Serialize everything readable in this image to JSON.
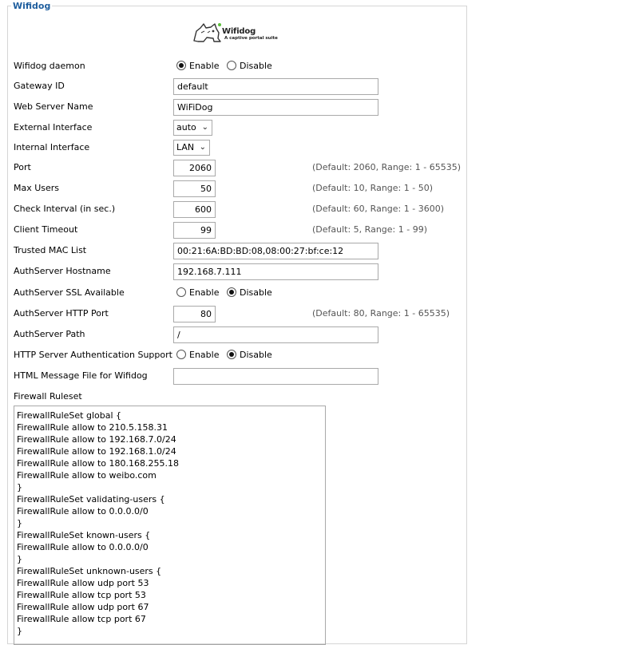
{
  "section": {
    "title": "Wifidog"
  },
  "logo": {
    "title": "Wifidog",
    "subtitle": "A captive portal suite"
  },
  "daemon": {
    "label": "Wifidog daemon",
    "options": [
      "Enable",
      "Disable"
    ],
    "selected": "Enable"
  },
  "gateway_id": {
    "label": "Gateway ID",
    "value": "default"
  },
  "web_server_name": {
    "label": "Web Server Name",
    "value": "WiFiDog"
  },
  "external_interface": {
    "label": "External Interface",
    "value": "auto"
  },
  "internal_interface": {
    "label": "Internal Interface",
    "value": "LAN"
  },
  "port": {
    "label": "Port",
    "value": "2060",
    "hint": "(Default: 2060, Range: 1 - 65535)"
  },
  "max_users": {
    "label": "Max Users",
    "value": "50",
    "hint": "(Default: 10, Range: 1 - 50)"
  },
  "check_interval": {
    "label": "Check Interval (in sec.)",
    "value": "600",
    "hint": "(Default: 60, Range: 1 - 3600)"
  },
  "client_timeout": {
    "label": "Client Timeout",
    "value": "99",
    "hint": "(Default: 5, Range: 1 - 99)"
  },
  "trusted_mac": {
    "label": "Trusted MAC List",
    "value": "00:21:6A:BD:BD:08,08:00:27:bf:ce:12"
  },
  "auth_hostname": {
    "label": "AuthServer Hostname",
    "value": "192.168.7.111"
  },
  "auth_ssl": {
    "label": "AuthServer SSL Available",
    "options": [
      "Enable",
      "Disable"
    ],
    "selected": "Disable"
  },
  "auth_http_port": {
    "label": "AuthServer HTTP Port",
    "value": "80",
    "hint": "(Default: 80, Range: 1 - 65535)"
  },
  "auth_path": {
    "label": "AuthServer Path",
    "value": "/"
  },
  "http_auth": {
    "label": "HTTP Server Authentication Support",
    "options": [
      "Enable",
      "Disable"
    ],
    "selected": "Disable"
  },
  "html_message": {
    "label": "HTML Message File for Wifidog",
    "value": ""
  },
  "firewall": {
    "label": "Firewall Ruleset",
    "lines": [
      "FirewallRuleSet global {",
      "FirewallRule allow to 210.5.158.31",
      "FirewallRule allow to 192.168.7.0/24",
      "FirewallRule allow to 192.168.1.0/24",
      "FirewallRule allow to 180.168.255.18",
      "FirewallRule allow to weibo.com",
      "}",
      "FirewallRuleSet validating-users {",
      "FirewallRule allow to 0.0.0.0/0",
      "}",
      "FirewallRuleSet known-users {",
      "FirewallRule allow to 0.0.0.0/0",
      "}",
      "FirewallRuleSet unknown-users {",
      "FirewallRule allow udp port 53",
      "FirewallRule allow tcp port 53",
      "FirewallRule allow udp port 67",
      "FirewallRule allow tcp port 67",
      "}"
    ]
  }
}
